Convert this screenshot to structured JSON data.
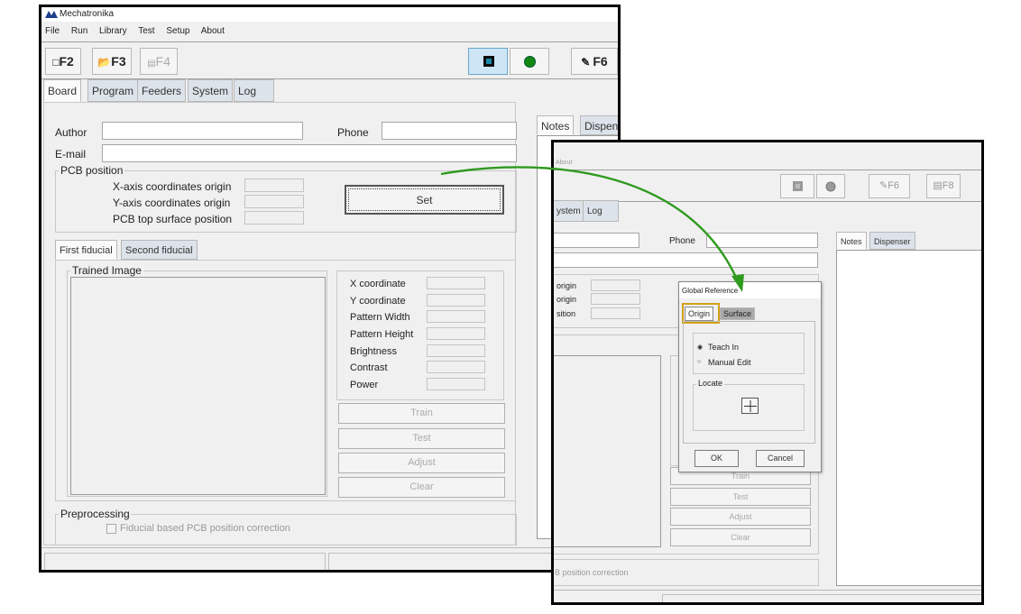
{
  "app": {
    "title": "Mechatronika"
  },
  "menu": [
    "File",
    "Run",
    "Library",
    "Test",
    "Setup",
    "About"
  ],
  "toolbar": {
    "f2": "F2",
    "f3": "F3",
    "f4": "F4",
    "f6": "F6"
  },
  "tabs": [
    "Board",
    "Program",
    "Feeders",
    "System",
    "Log"
  ],
  "form": {
    "author_label": "Author",
    "phone_label": "Phone",
    "email_label": "E-mail",
    "author_value": "",
    "phone_value": "",
    "email_value": ""
  },
  "pcb": {
    "title": "PCB position",
    "x_origin": "X-axis coordinates origin",
    "y_origin": "Y-axis coordinates origin",
    "top_surface": "PCB top surface position",
    "set_button": "Set"
  },
  "fiducial": {
    "tabs": [
      "First fiducial",
      "Second fiducial"
    ],
    "trained_image": "Trained Image",
    "fields": [
      "X coordinate",
      "Y coordinate",
      "Pattern Width",
      "Pattern Height",
      "Brightness",
      "Contrast",
      "Power"
    ],
    "buttons": [
      "Train",
      "Test",
      "Adjust",
      "Clear"
    ]
  },
  "preprocessing": {
    "title": "Preprocessing",
    "checkbox": "Fiducial based PCB position correction"
  },
  "side_tabs": [
    "Notes",
    "Dispens"
  ],
  "zoom": {
    "menu_fragment": "About",
    "toolbar": {
      "f6": "F6",
      "f8": "F8"
    },
    "tabs": [
      "ystem",
      "Log"
    ],
    "phone_label": "Phone",
    "side_tabs": [
      "Notes",
      "Dispenser"
    ],
    "pcb_fragments": [
      "origin",
      "origin",
      "sition"
    ],
    "buttons": [
      "Train",
      "Test",
      "Adjust",
      "Clear"
    ],
    "footer_fragment": "B position correction"
  },
  "dialog": {
    "title": "Global Reference",
    "tabs": [
      "Origin",
      "Surface"
    ],
    "teach_in": "Teach In",
    "manual_edit": "Manual Edit",
    "locate": "Locate",
    "ok": "OK",
    "cancel": "Cancel"
  },
  "colors": {
    "arrow": "#2e9a1e",
    "highlight": "#d4a017",
    "chip_active": "#1b8aa8",
    "led": "#118811"
  }
}
